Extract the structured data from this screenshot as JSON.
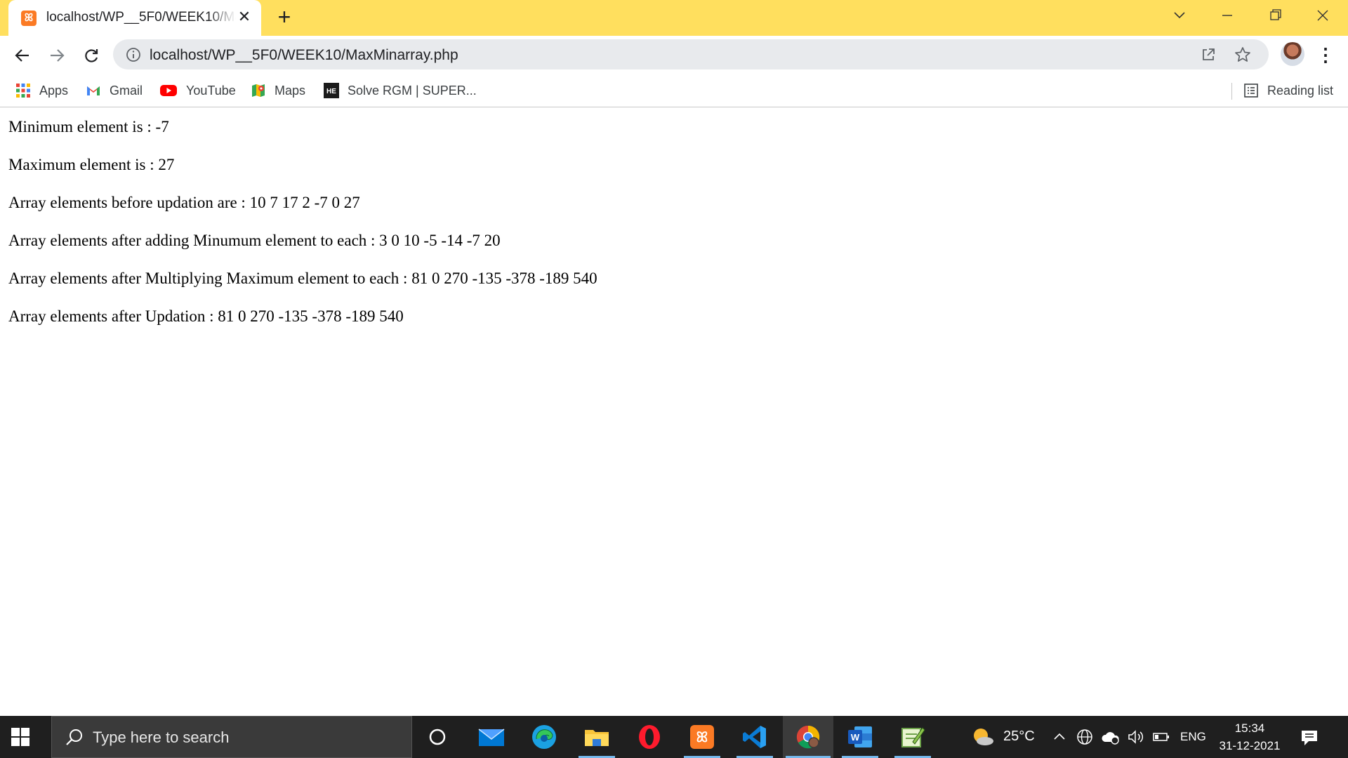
{
  "browser": {
    "tab": {
      "title": "localhost/WP__5F0/WEEK10/MaxMinarray.php",
      "favicon": "xampp-icon"
    },
    "address": {
      "url": "localhost/WP__5F0/WEEK10/MaxMinarray.php"
    },
    "bookmarks": [
      {
        "label": "Apps",
        "icon": "apps-grid-icon"
      },
      {
        "label": "Gmail",
        "icon": "gmail-icon"
      },
      {
        "label": "YouTube",
        "icon": "youtube-icon"
      },
      {
        "label": "Maps",
        "icon": "maps-icon"
      },
      {
        "label": "Solve RGM | SUPER...",
        "icon": "hackerearth-icon"
      }
    ],
    "reading_list": "Reading list"
  },
  "page": {
    "lines": [
      "Minimum element is : -7",
      "Maximum element is : 27",
      "Array elements before updation are : 10 7 17 2 -7 0 27",
      "Array elements after adding Minumum element to each : 3 0 10 -5 -14 -7 20",
      "Array elements after Multiplying Maximum element to each : 81 0 270 -135 -378 -189 540",
      "Array elements after Updation : 81 0 270 -135 -378 -189 540"
    ]
  },
  "taskbar": {
    "search_placeholder": "Type here to search",
    "weather": "25°C",
    "language": "ENG",
    "time": "15:34",
    "date": "31-12-2021"
  },
  "colors": {
    "titlebar": "#ffdf5e",
    "taskbar": "#1f1f1f",
    "omnibox": "#e8eaed"
  }
}
